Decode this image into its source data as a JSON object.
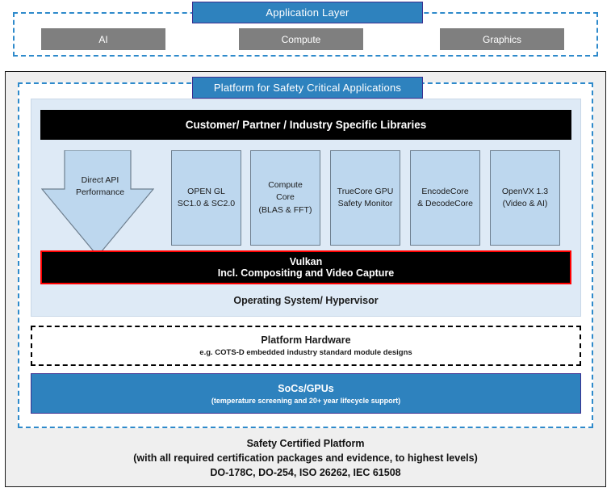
{
  "application_band": {
    "title": "Application Layer",
    "domains": [
      {
        "label": "AI"
      },
      {
        "label": "Compute"
      },
      {
        "label": "Graphics"
      }
    ]
  },
  "platform": {
    "title": "Platform for Safety Critical Applications",
    "libraries_bar": "Customer/ Partner / Industry Specific Libraries",
    "components": [
      {
        "line1": "Direct API",
        "line2": "Performance",
        "line3": ""
      },
      {
        "line1": "OPEN GL",
        "line2": "SC1.0 & SC2.0",
        "line3": ""
      },
      {
        "line1": "Compute",
        "line2": "Core",
        "line3": "(BLAS & FFT)"
      },
      {
        "line1": "TrueCore GPU",
        "line2": "Safety Monitor",
        "line3": ""
      },
      {
        "line1": "EncodeCore",
        "line2": "& DecodeCore",
        "line3": ""
      },
      {
        "line1": "OpenVX 1.3",
        "line2": "(Video & AI)",
        "line3": ""
      }
    ],
    "vulkan": {
      "line1": "Vulkan",
      "line2": "Incl. Compositing and Video Capture"
    },
    "os_layer": "Operating System/ Hypervisor",
    "hardware": {
      "line1": "Platform Hardware",
      "line2": "e.g. COTS-D embedded industry standard module designs"
    },
    "socs": {
      "line1": "SoCs/GPUs",
      "line2": "(temperature screening and 20+ year lifecycle support)"
    }
  },
  "footer": {
    "line1": "Safety Certified Platform",
    "line2": "(with all required certification packages and evidence, to highest levels)",
    "line3": "DO-178C, DO-254, ISO 26262, IEC 61508"
  },
  "colors": {
    "accent_blue": "#2E82BE",
    "pill_border": "#3B2F8F",
    "dashed_blue": "#2E8ACB",
    "gray_box": "#7F7F7F",
    "panel_blue": "#DEEAF6",
    "component_blue": "#BDD7EE",
    "vulkan_border_red": "#FF0000",
    "bar_black": "#000000",
    "frame_gray": "#EFEFEF"
  }
}
